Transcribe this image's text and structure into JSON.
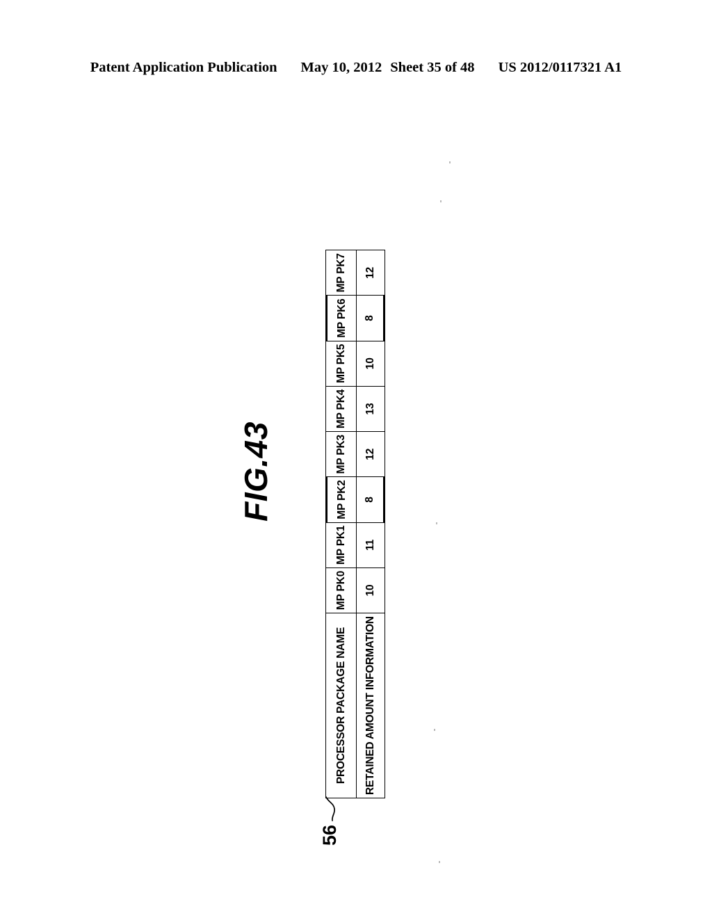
{
  "header": {
    "publication": "Patent Application Publication",
    "date": "May 10, 2012",
    "sheet": "Sheet 35 of 48",
    "patent_number": "US 2012/0117321 A1"
  },
  "figure": {
    "title": "FIG.43",
    "reference_numeral": "56",
    "orientation": "rotated-90-ccw"
  },
  "table": {
    "row_labels": [
      "PROCESSOR PACKAGE NAME",
      "RETAINED AMOUNT INFORMATION"
    ],
    "columns": [
      {
        "name": "MP PK0",
        "retained_amount": "10",
        "highlighted": false
      },
      {
        "name": "MP PK1",
        "retained_amount": "11",
        "highlighted": false
      },
      {
        "name": "MP PK2",
        "retained_amount": "8",
        "highlighted": true
      },
      {
        "name": "MP PK3",
        "retained_amount": "12",
        "highlighted": false
      },
      {
        "name": "MP PK4",
        "retained_amount": "13",
        "highlighted": false
      },
      {
        "name": "MP PK5",
        "retained_amount": "10",
        "highlighted": false
      },
      {
        "name": "MP PK6",
        "retained_amount": "8",
        "highlighted": true
      },
      {
        "name": "MP PK7",
        "retained_amount": "12",
        "highlighted": false
      }
    ]
  },
  "colors": {
    "ink": "#000000",
    "paper": "#ffffff"
  }
}
